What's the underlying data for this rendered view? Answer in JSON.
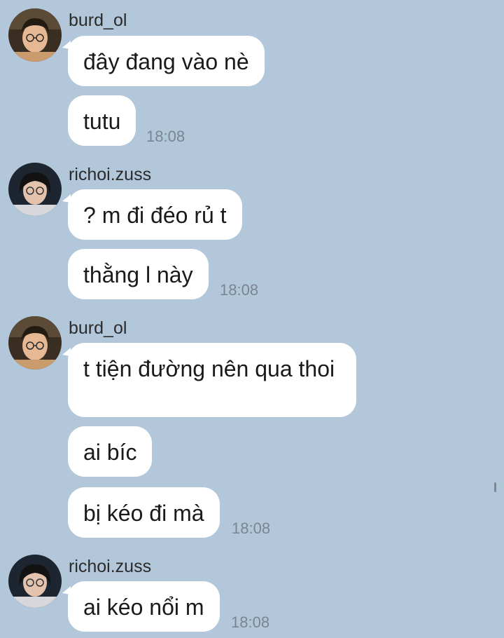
{
  "colors": {
    "background": "#b2c7da",
    "bubble": "#ffffff",
    "timestamp": "#7b8591"
  },
  "groups": [
    {
      "sender": "burd_ol",
      "avatar": "avatar-burd-ol",
      "messages": [
        "đây đang vào nè",
        "tutu"
      ],
      "time": "18:08"
    },
    {
      "sender": "richoi.zuss",
      "avatar": "avatar-richoi-zuss",
      "messages": [
        "? m đi đéo rủ t",
        "thằng l này"
      ],
      "time": "18:08"
    },
    {
      "sender": "burd_ol",
      "avatar": "avatar-burd-ol",
      "messages": [
        "t tiện đường nên qua thoi",
        "ai bíc",
        "bị kéo đi mà"
      ],
      "time": "18:08"
    },
    {
      "sender": "richoi.zuss",
      "avatar": "avatar-richoi-zuss",
      "messages": [
        "ai kéo nổi m"
      ],
      "time": "18:08"
    }
  ]
}
